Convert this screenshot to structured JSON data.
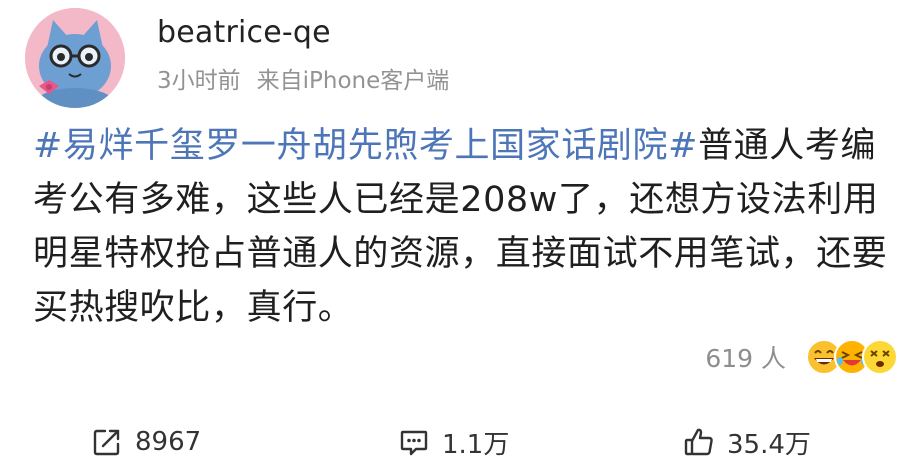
{
  "post": {
    "username": "beatrice-qe",
    "time": "3小时前",
    "source": "来自iPhone客户端",
    "topic": "#易烊千玺罗一舟胡先煦考上国家话剧院#",
    "body": "普通人考编考公有多难，这些人已经是208w了，还想方设法利用明星特权抢占普通人的资源，直接面试不用笔试，还要买热搜吹比，真行。"
  },
  "reactions": {
    "count": "619 人",
    "emojis": [
      "grin-emoji",
      "laugh-tears-emoji",
      "dizzy-emoji"
    ]
  },
  "actions": {
    "repost_count": "8967",
    "comment_count": "1.1万",
    "like_count": "35.4万"
  },
  "colors": {
    "topic": "#4d76b8",
    "meta": "#939393",
    "avatar_bg": "#f3b9c9",
    "avatar_cat": "#6e9fd2"
  }
}
